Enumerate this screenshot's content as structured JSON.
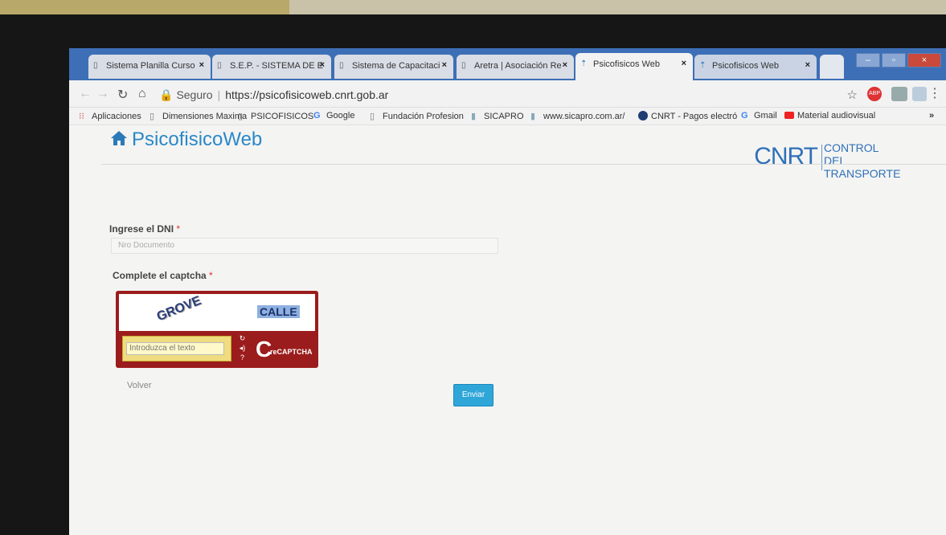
{
  "tabs": [
    {
      "label": "Sistema Planilla Curso"
    },
    {
      "label": "S.E.P. - SISTEMA DE E"
    },
    {
      "label": "Sistema de Capacitaci"
    },
    {
      "label": "Aretra | Asociación Re"
    },
    {
      "label": "Psicofisicos Web"
    },
    {
      "label": "Psicofisicos Web"
    }
  ],
  "address_bar": {
    "security": "Seguro",
    "url": "https://psicofisicoweb.cnrt.gob.ar"
  },
  "bookmarks": [
    {
      "label": "Aplicaciones"
    },
    {
      "label": "Dimensiones Maxima"
    },
    {
      "label": "PSICOFISICOS"
    },
    {
      "label": "Google"
    },
    {
      "label": "Fundación Profesion"
    },
    {
      "label": "SICAPRO"
    },
    {
      "label": "www.sicapro.com.ar/"
    },
    {
      "label": "CNRT - Pagos electró"
    },
    {
      "label": "Gmail"
    },
    {
      "label": "Material audiovisual"
    }
  ],
  "page": {
    "app_name": "PsicofisicoWeb",
    "org_logo": "CNRT",
    "org_subtitle_1": "CONTROL",
    "org_subtitle_2": "DEL TRANSPORTE",
    "dni_label": "Ingrese el DNI",
    "dni_placeholder": "Nro Documento",
    "captcha_label": "Complete el captcha",
    "required_mark": "*",
    "captcha_word_1": "GROVE",
    "captcha_word_2": "CALLE",
    "captcha_placeholder": "Introduzca el texto",
    "captcha_brand": "reCAPTCHA",
    "volver_label": "Volver",
    "enviar_label": "Enviar"
  }
}
